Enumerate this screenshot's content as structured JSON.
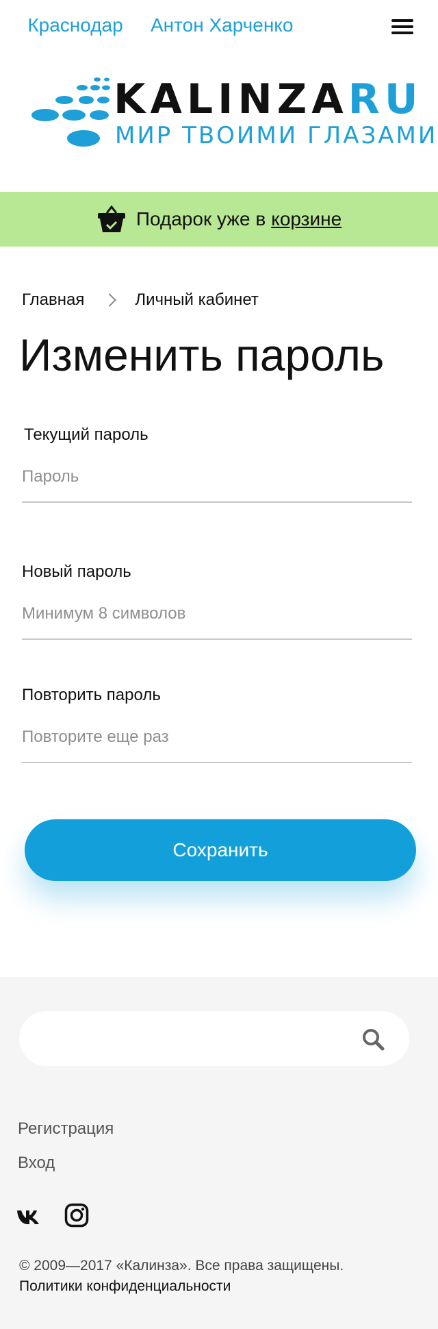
{
  "header": {
    "city": "Краснодар",
    "user": "Антон Харченко",
    "logo": {
      "brand": "KALINZA",
      "brand_suffix": "RU",
      "tagline": "МИР ТВОИМИ ГЛАЗАМИ"
    }
  },
  "banner": {
    "text": "Подарок уже в",
    "link": "корзине"
  },
  "breadcrumb": {
    "home": "Главная",
    "current": "Личный кабинет"
  },
  "page": {
    "title": "Изменить пароль"
  },
  "form": {
    "current_password": {
      "label": "Текущий пароль",
      "placeholder": "Пароль",
      "value": ""
    },
    "new_password": {
      "label": "Новый пароль",
      "placeholder": "Минимум 8 символов",
      "value": ""
    },
    "repeat_password": {
      "label": "Повторить пароль",
      "placeholder": "Повторите еще раз",
      "value": ""
    },
    "submit": "Сохранить"
  },
  "footer": {
    "search": {
      "placeholder": "",
      "value": ""
    },
    "links": {
      "register": "Регистрация",
      "login": "Вход"
    },
    "social": [
      "vk-icon",
      "instagram-icon"
    ],
    "copyright": "© 2009—2017 «Калинза». Все права защищены.",
    "privacy": "Политики конфиденциальности"
  },
  "colors": {
    "accent": "#129fda",
    "banner": "#b9e894",
    "footer_bg": "#f5f5f5"
  }
}
